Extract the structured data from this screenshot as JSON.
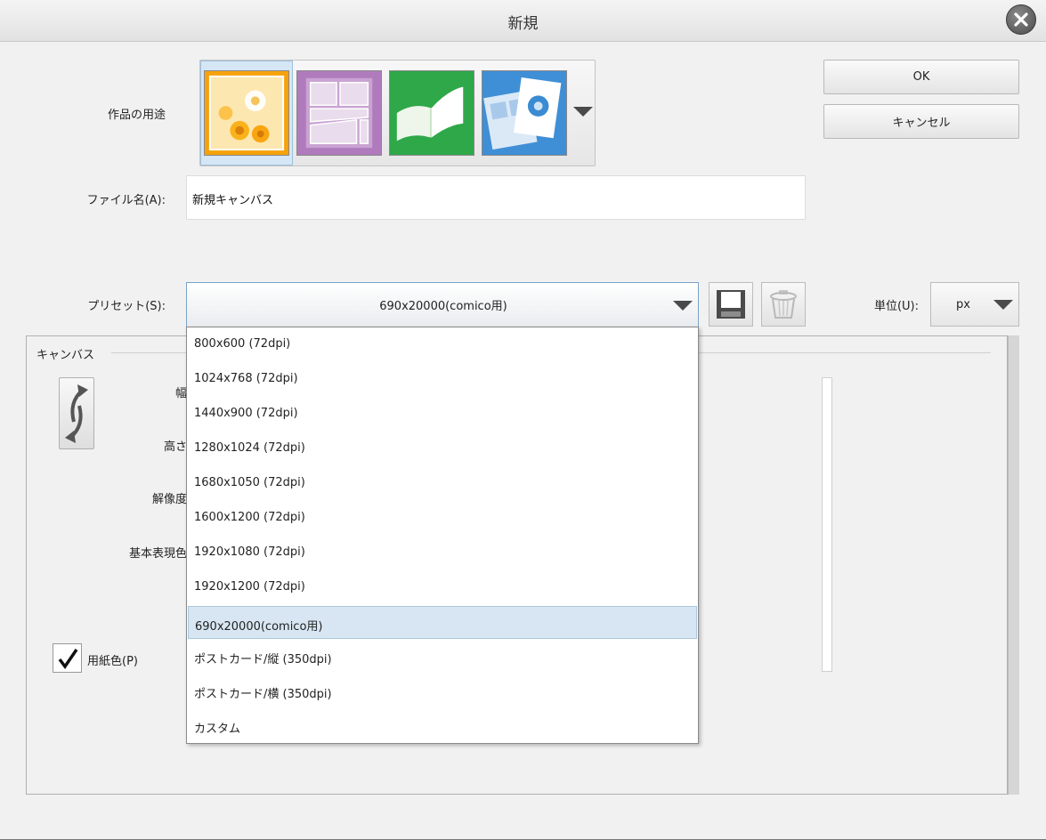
{
  "window": {
    "title": "新規"
  },
  "buttons": {
    "ok": "OK",
    "cancel": "キャンセル"
  },
  "usage": {
    "label": "作品の用途",
    "options": [
      "illustration-icon",
      "comic-icon",
      "book-icon",
      "all-comic-settings-icon"
    ],
    "selected_index": 0
  },
  "file_name": {
    "label": "ファイル名(A):",
    "value": "新規キャンバス"
  },
  "preset": {
    "label": "プリセット(S):",
    "value": "690x20000(comico用)",
    "options": [
      "800x600 (72dpi)",
      "1024x768 (72dpi)",
      "1440x900 (72dpi)",
      "1280x1024 (72dpi)",
      "1680x1050 (72dpi)",
      "1600x1200 (72dpi)",
      "1920x1080 (72dpi)",
      "1920x1200 (72dpi)",
      "690x20000(comico用)",
      "ポストカード/縦 (350dpi)",
      "ポストカード/横 (350dpi)",
      "カスタム"
    ],
    "selected_index": 8
  },
  "unit": {
    "label": "単位(U):",
    "value": "px"
  },
  "canvas": {
    "section_label": "キャンバス",
    "width_label": "幅",
    "height_label": "高さ",
    "resolution_label": "解像度",
    "color_label": "基本表現色",
    "paper_color_label": "用紙色(P)",
    "paper_color_checked": true
  },
  "colors": {
    "accent": "#7aa3c8",
    "selected_row": "#d7e6f2"
  }
}
